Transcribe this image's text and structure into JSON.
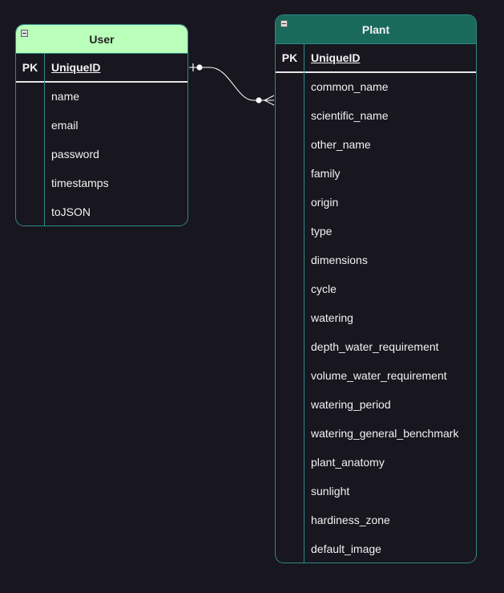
{
  "entities": {
    "user": {
      "title": "User",
      "pk_label": "PK",
      "pk_field": "UniqueID",
      "fields": [
        "name",
        "email",
        "password",
        "timestamps",
        "toJSON"
      ]
    },
    "plant": {
      "title": "Plant",
      "pk_label": "PK",
      "pk_field": "UniqueID",
      "fields": [
        "common_name",
        "scientific_name",
        "other_name",
        "family",
        "origin",
        "type",
        "dimensions",
        "cycle",
        "watering",
        "depth_water_requirement",
        "volume_water_requirement",
        "watering_period",
        "watering_general_benchmark",
        "plant_anatomy",
        "sunlight",
        "hardiness_zone",
        "default_image"
      ]
    }
  },
  "relationship": {
    "from": "User.UniqueID",
    "to": "Plant.UniqueID",
    "from_cardinality": "one-and-only-one",
    "to_cardinality": "zero-or-many"
  },
  "colors": {
    "background": "#18161e",
    "entity_border": "#2f8a8a",
    "user_header": "#baffba",
    "plant_header": "#1a6a5c",
    "text": "#f2f2f2",
    "connector": "#ffffff"
  }
}
